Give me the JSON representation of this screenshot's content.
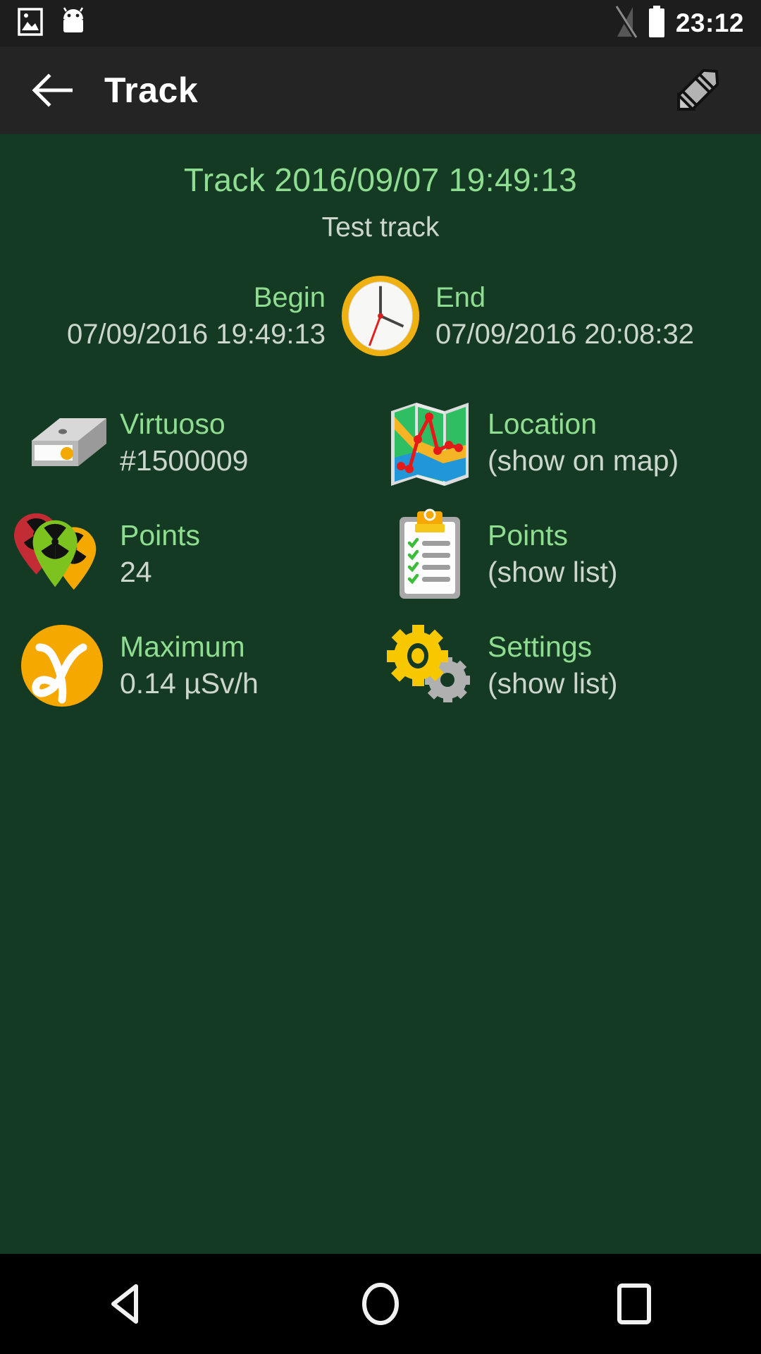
{
  "status_bar": {
    "time": "23:12",
    "icons": [
      "image-icon",
      "android-bugdroid-icon",
      "signal-off-icon",
      "battery-icon"
    ]
  },
  "app_bar": {
    "back_icon": "arrow-back-icon",
    "title": "Track",
    "edit_icon": "pencil-icon"
  },
  "header": {
    "title": "Track 2016/09/07 19:49:13",
    "subtitle": "Test track"
  },
  "time_section": {
    "clock_icon": "clock-icon",
    "begin_label": "Begin",
    "begin_value": "07/09/2016 19:49:13",
    "end_label": "End",
    "end_value": "07/09/2016 20:08:32"
  },
  "cells": [
    {
      "icon": "device-drive-icon",
      "label": "Virtuoso",
      "value": "#1500009"
    },
    {
      "icon": "map-track-icon",
      "label": "Location",
      "value": "(show on map)"
    },
    {
      "icon": "radiation-pins-icon",
      "label": "Points",
      "value": "24"
    },
    {
      "icon": "clipboard-list-icon",
      "label": "Points",
      "value": "(show list)"
    },
    {
      "icon": "gamma-dose-icon",
      "label": "Maximum",
      "value": "0.14 µSv/h"
    },
    {
      "icon": "gears-icon",
      "label": "Settings",
      "value": "(show list)"
    }
  ],
  "nav_bar": {
    "back": "nav-back-icon",
    "home": "nav-home-icon",
    "recents": "nav-recents-icon"
  },
  "colors": {
    "background": "#143a23",
    "label_green": "#8fdd90",
    "value_gray": "#ccd6cd",
    "appbar": "#242424",
    "statusbar": "#1d1d1d",
    "accent_orange": "#f5a800"
  }
}
